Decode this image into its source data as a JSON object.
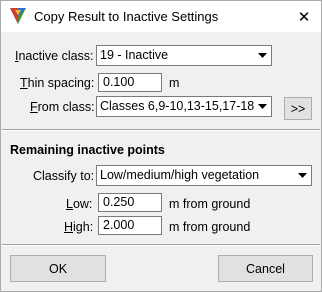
{
  "dialog": {
    "title": "Copy Result to Inactive Settings",
    "close_glyph": "✕"
  },
  "inactive_class": {
    "label": "Inactive class:",
    "value": "19 - Inactive"
  },
  "thin_spacing": {
    "label": "Thin spacing:",
    "value": "0.100",
    "unit": "m"
  },
  "from_class": {
    "label": "From class:",
    "value": "Classes 6,9-10,13-15,17-18",
    "browse_label": ">>"
  },
  "remaining": {
    "heading": "Remaining inactive points",
    "classify_to": {
      "label": "Classify to:",
      "value": "Low/medium/high vegetation"
    },
    "low": {
      "label": "Low:",
      "value": "0.250",
      "unit": "m from ground"
    },
    "high": {
      "label": "High:",
      "value": "2.000",
      "unit": "m from ground"
    }
  },
  "buttons": {
    "ok": "OK",
    "cancel": "Cancel"
  },
  "colors": {
    "window_bg": "#f0f0f0",
    "titlebar_bg": "#ffffff",
    "button_bg": "#e1e1e1",
    "border": "#7a7a7a"
  },
  "icons": {
    "app": "terrasolid-app-icon",
    "close": "close-icon",
    "dropdown": "chevron-down-icon"
  }
}
